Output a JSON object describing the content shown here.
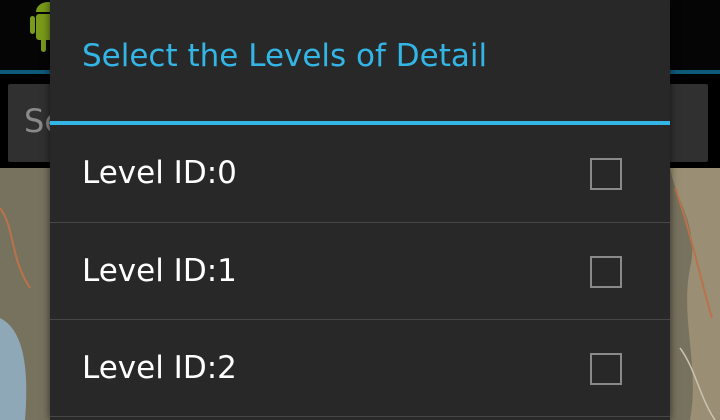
{
  "app": {
    "icon": "android-robot-icon",
    "search_hint": "Se"
  },
  "dialog": {
    "title": "Select the Levels of Detail",
    "items": [
      {
        "label": "Level ID:0",
        "checked": false
      },
      {
        "label": "Level ID:1",
        "checked": false
      },
      {
        "label": "Level ID:2",
        "checked": false
      }
    ]
  },
  "colors": {
    "accent": "#33b5e5",
    "dialog_background": "#282828",
    "text": "#ffffff"
  }
}
